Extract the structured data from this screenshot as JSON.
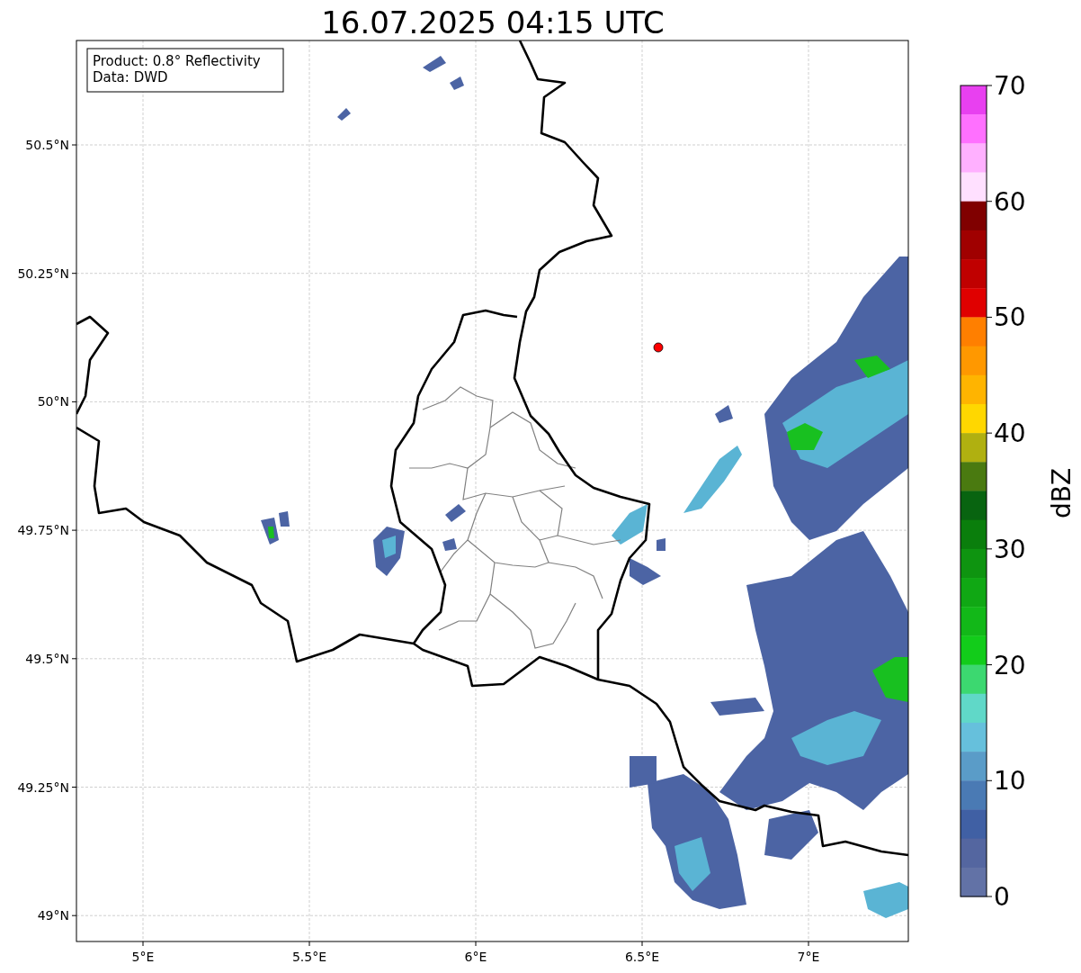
{
  "title": "16.07.2025 04:15 UTC",
  "info_box": {
    "lines": [
      "Product: 0.8° Reflectivity",
      "Data: DWD"
    ]
  },
  "x_axis": {
    "ticks": [
      "5°E",
      "5.5°E",
      "6°E",
      "6.5°E",
      "7°E"
    ]
  },
  "y_axis": {
    "ticks": [
      "50.5°N",
      "50.25°N",
      "50°N",
      "49.75°N",
      "49.5°N",
      "49.25°N",
      "49°N"
    ]
  },
  "colorbar": {
    "label": "dBZ",
    "ticks": [
      "70",
      "60",
      "50",
      "40",
      "30",
      "20",
      "10",
      "0"
    ],
    "segments": [
      {
        "color": "#e840f0"
      },
      {
        "color": "#ff70ff"
      },
      {
        "color": "#ffb0ff"
      },
      {
        "color": "#ffe0ff"
      },
      {
        "color": "#800000"
      },
      {
        "color": "#a00000"
      },
      {
        "color": "#c00000"
      },
      {
        "color": "#e00000"
      },
      {
        "color": "#ff7f00"
      },
      {
        "color": "#ff9800"
      },
      {
        "color": "#ffb400"
      },
      {
        "color": "#ffd700"
      },
      {
        "color": "#b0b010"
      },
      {
        "color": "#4a7a10"
      },
      {
        "color": "#086410"
      },
      {
        "color": "#0a7e0c"
      },
      {
        "color": "#0e9410"
      },
      {
        "color": "#10a814"
      },
      {
        "color": "#12b818"
      },
      {
        "color": "#12cc1a"
      },
      {
        "color": "#3cd870"
      },
      {
        "color": "#60d8c8"
      },
      {
        "color": "#66c0dc"
      },
      {
        "color": "#5a9cc8"
      },
      {
        "color": "#4a7ab4"
      },
      {
        "color": "#4060a4"
      },
      {
        "color": "#5466a0"
      },
      {
        "color": "#6272a6"
      }
    ]
  }
}
